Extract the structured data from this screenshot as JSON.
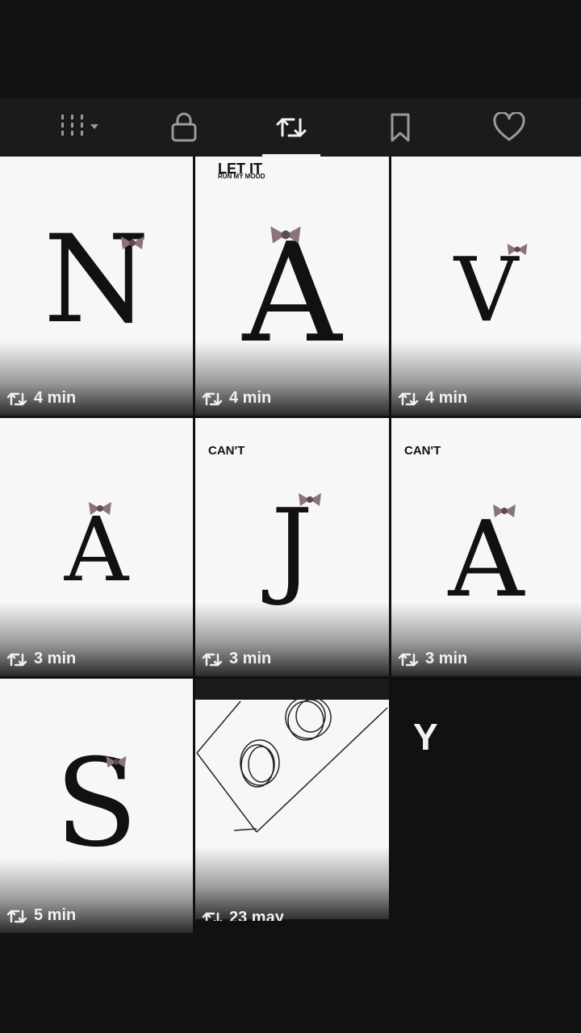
{
  "tabs": [
    {
      "icon": "grid-dropdown-icon"
    },
    {
      "icon": "lock-icon"
    },
    {
      "icon": "repost-icon",
      "active": true
    },
    {
      "icon": "bookmark-icon"
    },
    {
      "icon": "heart-icon"
    }
  ],
  "posts": [
    {
      "letter": "N",
      "time": "4 min"
    },
    {
      "letter": "A",
      "time": "4 min",
      "caption_title": "LET IT",
      "caption_sub": "RUN MY MOOD"
    },
    {
      "letter": "V",
      "time": "4 min"
    },
    {
      "letter": "A",
      "time": "3 min"
    },
    {
      "letter": "J",
      "time": "3 min",
      "caption": "CAN'T"
    },
    {
      "letter": "A",
      "time": "3 min",
      "caption": "CAN'T"
    },
    {
      "letter": "S",
      "time": "5 min"
    },
    {
      "letter": "",
      "time": "23 may"
    }
  ],
  "overlay_text": "Y"
}
